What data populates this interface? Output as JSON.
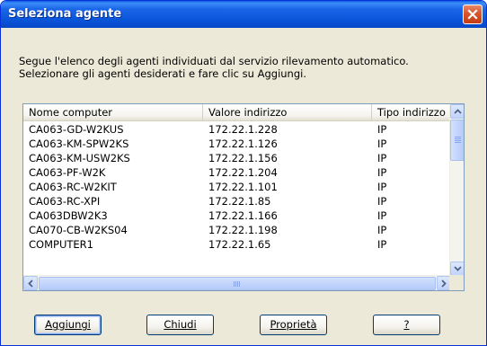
{
  "window": {
    "title": "Seleziona agente"
  },
  "description": {
    "line1": "Segue l'elenco degli agenti individuati dal servizio rilevamento automatico.",
    "line2": "Selezionare gli agenti desiderati e fare clic su Aggiungi."
  },
  "list": {
    "columns": [
      "Nome computer",
      "Valore indirizzo",
      "Tipo indirizzo"
    ],
    "rows": [
      [
        "CA063-GD-W2KUS",
        "172.22.1.228",
        "IP"
      ],
      [
        "CA063-KM-SPW2KS",
        "172.22.1.126",
        "IP"
      ],
      [
        "CA063-KM-USW2KS",
        "172.22.1.156",
        "IP"
      ],
      [
        "CA063-PF-W2K",
        "172.22.1.204",
        "IP"
      ],
      [
        "CA063-RC-W2KIT",
        "172.22.1.101",
        "IP"
      ],
      [
        "CA063-RC-XPI",
        "172.22.1.85",
        "IP"
      ],
      [
        "CA063DBW2K3",
        "172.22.1.166",
        "IP"
      ],
      [
        "CA070-CB-W2KS04",
        "172.22.1.198",
        "IP"
      ],
      [
        "COMPUTER1",
        "172.22.1.65",
        "IP"
      ]
    ]
  },
  "buttons": {
    "add": "Aggiungi",
    "close": "Chiudi",
    "properties": "Proprietà",
    "help": "?"
  },
  "icons": {
    "close": "close-icon",
    "scroll_up": "chevron-up-icon",
    "scroll_down": "chevron-down-icon",
    "scroll_left": "chevron-left-icon",
    "scroll_right": "chevron-right-icon"
  },
  "colors": {
    "titlebar": "#0a55d9",
    "close_button": "#d8542b",
    "dialog_bg": "#ece9d8",
    "list_border": "#7f9db9"
  }
}
